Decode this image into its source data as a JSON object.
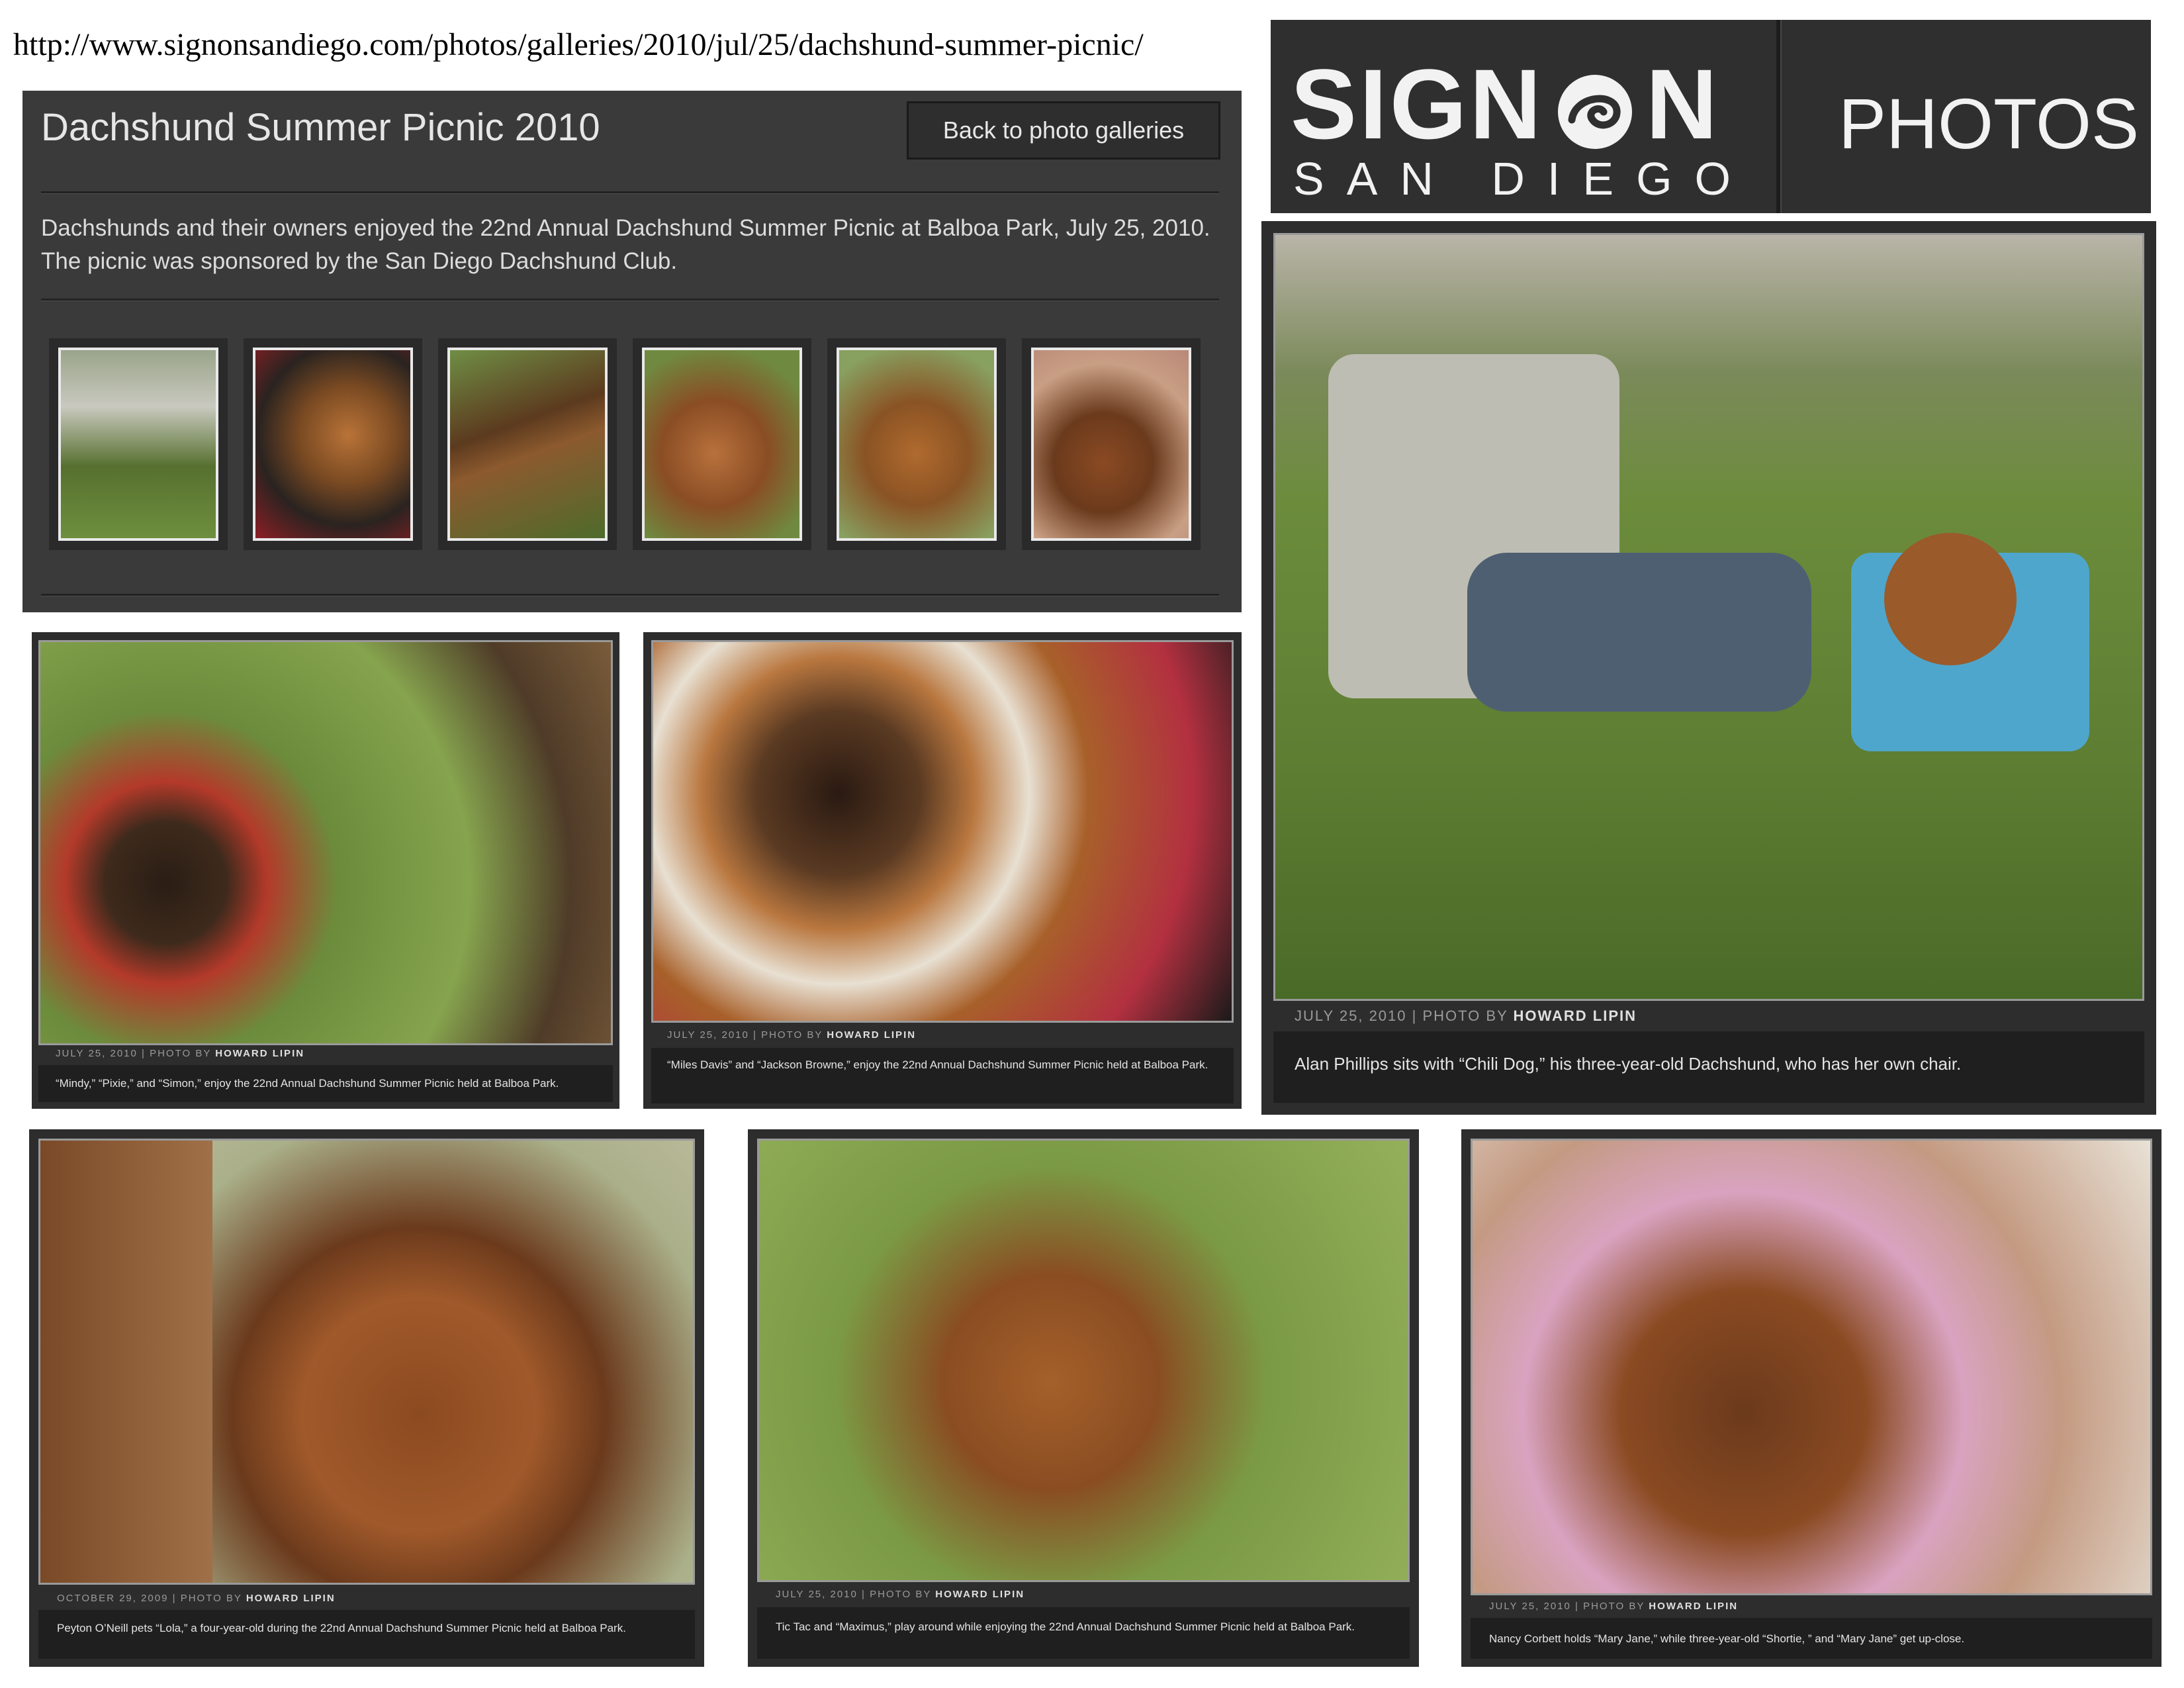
{
  "url": "http://www.signonsandiego.com/photos/galleries/2010/jul/25/dachshund-summer-picnic/",
  "gallery": {
    "title": "Dachshund Summer Picnic 2010",
    "back_button": "Back to photo galleries",
    "description": "Dachshunds and their owners enjoyed the 22nd Annual Dachshund Summer Picnic at Balboa Park, July 25, 2010. The picnic was sponsored by the San Diego Dachshund Club.",
    "thumbnail_count": 6
  },
  "brand": {
    "logo_top": "SIGN",
    "logo_top_end": "N",
    "logo_bottom": "SAN DIEGO",
    "section": "PHOTOS"
  },
  "photos": [
    {
      "date": "JULY 25, 2010",
      "separator": " | PHOTO BY ",
      "photographer": "HOWARD LIPIN",
      "caption": "“Mindy,” “Pixie,” and “Simon,” enjoy the 22nd Annual Dachshund Summer Picnic held at Balboa Park."
    },
    {
      "date": "JULY 25, 2010",
      "separator": " | PHOTO BY ",
      "photographer": "HOWARD LIPIN",
      "caption": "“Miles Davis” and “Jackson Browne,” enjoy the 22nd Annual Dachshund Summer Picnic held at Balboa Park."
    },
    {
      "date": "JULY 25, 2010",
      "separator": " | PHOTO BY ",
      "photographer": "HOWARD LIPIN",
      "caption": "Alan Phillips sits with “Chili Dog,” his three-year-old Dachshund, who has her own chair."
    },
    {
      "date": "OCTOBER 29, 2009",
      "separator": " | PHOTO BY ",
      "photographer": "HOWARD LIPIN",
      "caption": "Peyton O’Neill pets “Lola,” a four-year-old during the 22nd Annual Dachshund Summer Picnic held at Balboa Park."
    },
    {
      "date": "JULY 25, 2010",
      "separator": " | PHOTO BY ",
      "photographer": "HOWARD LIPIN",
      "caption": "Tic Tac and “Maximus,” play around while enjoying the 22nd Annual Dachshund Summer Picnic held at Balboa Park."
    },
    {
      "date": "JULY 25, 2010",
      "separator": " | PHOTO BY ",
      "photographer": "HOWARD LIPIN",
      "caption": "Nancy Corbett holds “Mary Jane,” while three-year-old “Shortie, ” and “Mary Jane” get up-close."
    }
  ]
}
